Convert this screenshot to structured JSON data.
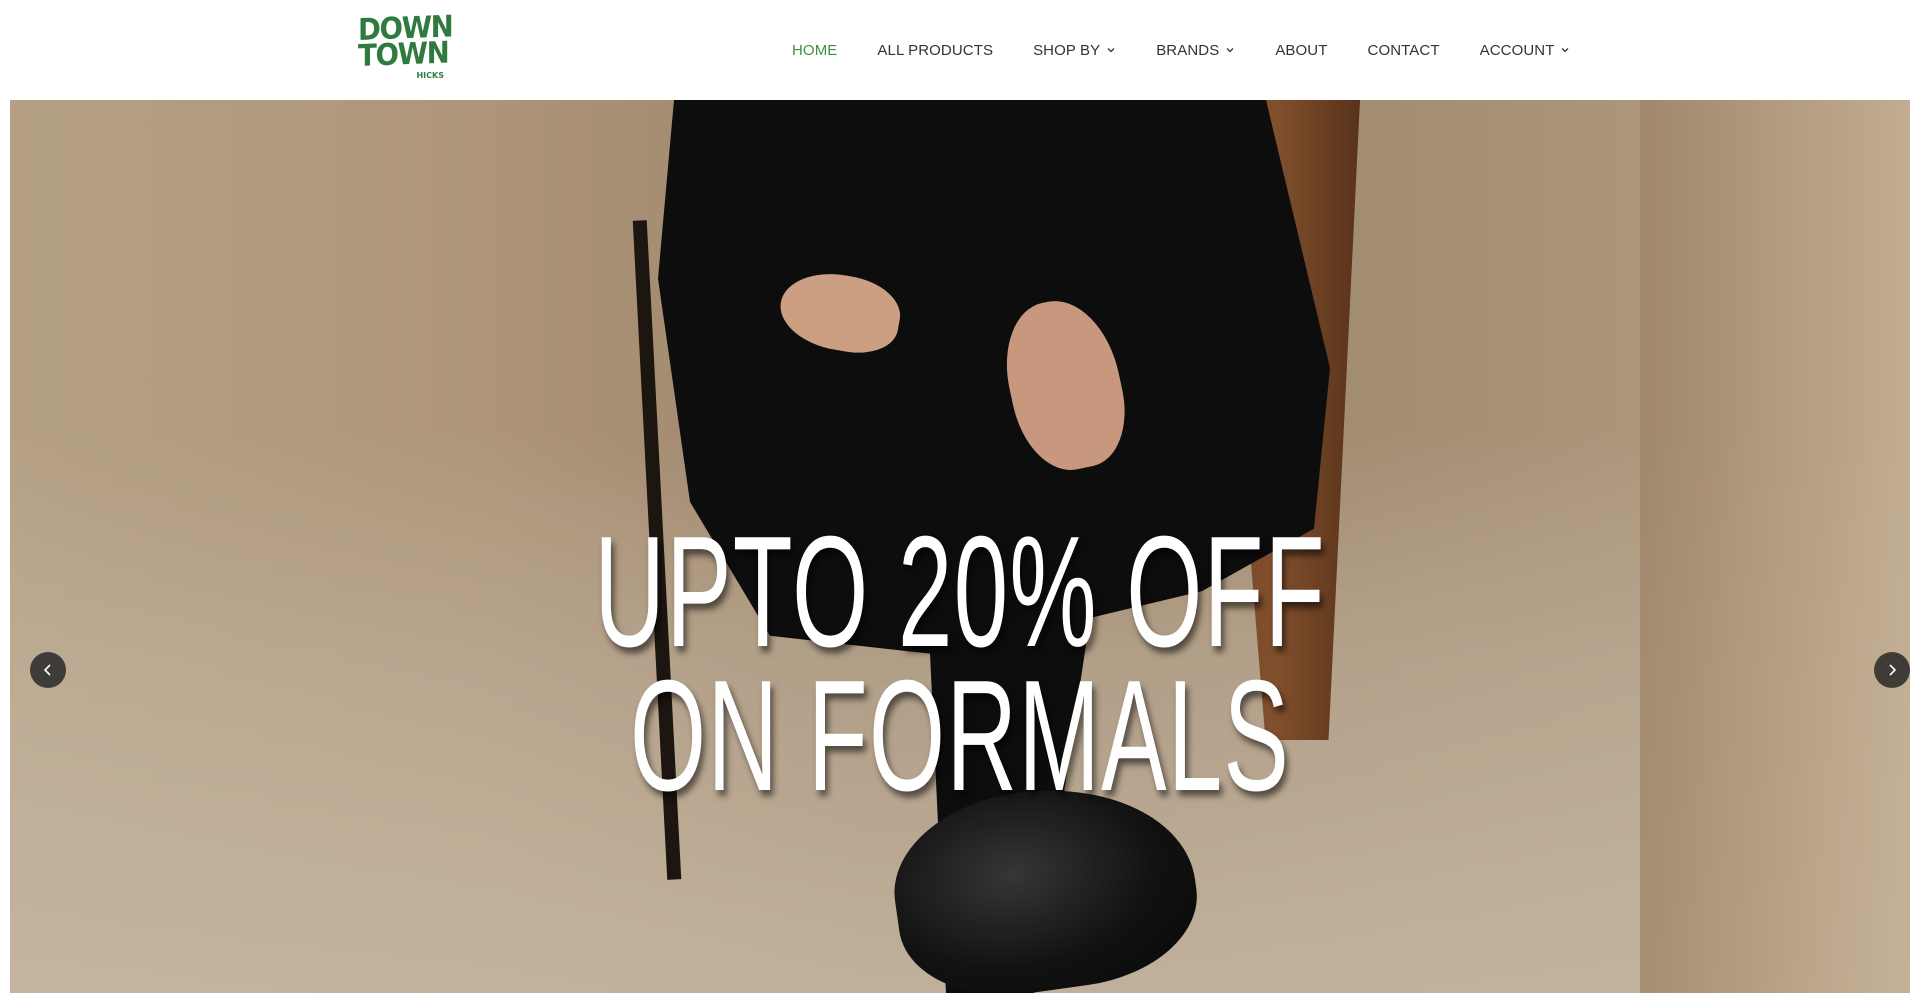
{
  "brand": {
    "logo_line1": "DOWN",
    "logo_line2": "TOWN",
    "logo_small": "HICKS",
    "color": "#2f7a3f"
  },
  "nav": {
    "items": [
      {
        "label": "HOME",
        "active": true,
        "dropdown": false
      },
      {
        "label": "ALL PRODUCTS",
        "active": false,
        "dropdown": false
      },
      {
        "label": "SHOP BY",
        "active": false,
        "dropdown": true,
        "icon": "chevron-down-icon"
      },
      {
        "label": "BRANDS",
        "active": false,
        "dropdown": true,
        "icon": "chevron-down-icon"
      },
      {
        "label": "ABOUT",
        "active": false,
        "dropdown": false
      },
      {
        "label": "CONTACT",
        "active": false,
        "dropdown": false
      },
      {
        "label": "ACCOUNT",
        "active": false,
        "dropdown": true,
        "icon": "chevron-down-icon"
      }
    ],
    "active_color": "#3f8f3f",
    "text_color": "#333333"
  },
  "hero": {
    "headline_line1": "UPTO 20% OFF",
    "headline_line2": "ON FORMALS",
    "prev_icon": "chevron-left-icon",
    "next_icon": "chevron-right-icon"
  }
}
